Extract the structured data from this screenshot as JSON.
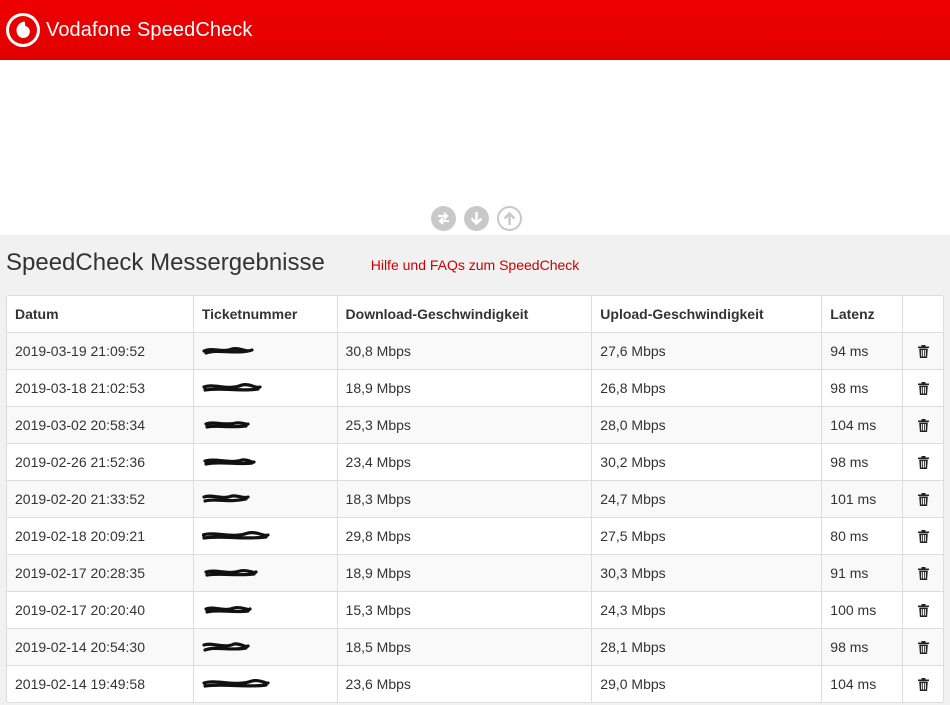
{
  "header": {
    "title": "Vodafone SpeedCheck"
  },
  "hero": {
    "icons": [
      "ping-icon",
      "download-icon",
      "upload-icon"
    ],
    "help_link": "Hilfe und FAQs zum SpeedCheck"
  },
  "results": {
    "title": "SpeedCheck Messergebnisse",
    "columns": [
      "Datum",
      "Ticketnummer",
      "Download-Geschwindigkeit",
      "Upload-Geschwindigkeit",
      "Latenz",
      ""
    ],
    "rows": [
      {
        "date": "2019-03-19 21:09:52",
        "download": "30,8 Mbps",
        "upload": "27,6 Mbps",
        "latency": "94 ms"
      },
      {
        "date": "2019-03-18 21:02:53",
        "download": "18,9 Mbps",
        "upload": "26,8 Mbps",
        "latency": "98 ms"
      },
      {
        "date": "2019-03-02 20:58:34",
        "download": "25,3 Mbps",
        "upload": "28,0 Mbps",
        "latency": "104 ms"
      },
      {
        "date": "2019-02-26 21:52:36",
        "download": "23,4 Mbps",
        "upload": "30,2 Mbps",
        "latency": "98 ms"
      },
      {
        "date": "2019-02-20 21:33:52",
        "download": "18,3 Mbps",
        "upload": "24,7 Mbps",
        "latency": "101 ms"
      },
      {
        "date": "2019-02-18 20:09:21",
        "download": "29,8 Mbps",
        "upload": "27,5 Mbps",
        "latency": "80 ms"
      },
      {
        "date": "2019-02-17 20:28:35",
        "download": "18,9 Mbps",
        "upload": "30,3 Mbps",
        "latency": "91 ms"
      },
      {
        "date": "2019-02-17 20:20:40",
        "download": "15,3 Mbps",
        "upload": "24,3 Mbps",
        "latency": "100 ms"
      },
      {
        "date": "2019-02-14 20:54:30",
        "download": "18,5 Mbps",
        "upload": "28,1 Mbps",
        "latency": "98 ms"
      },
      {
        "date": "2019-02-14 19:49:58",
        "download": "23,6 Mbps",
        "upload": "29,0 Mbps",
        "latency": "104 ms"
      }
    ]
  },
  "colors": {
    "brand_red": "#e60000",
    "link_red": "#cc0000"
  }
}
